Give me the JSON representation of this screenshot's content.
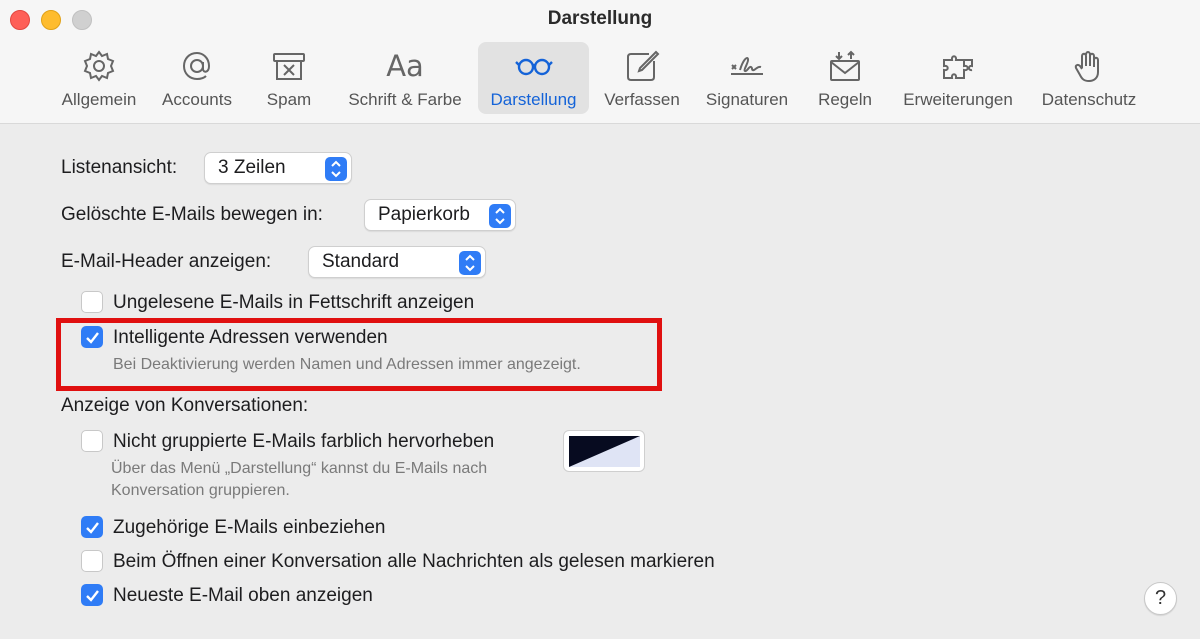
{
  "window": {
    "title": "Darstellung"
  },
  "toolbar": {
    "items": [
      {
        "label": "Allgemein",
        "icon": "gear-icon"
      },
      {
        "label": "Accounts",
        "icon": "at-sign-icon"
      },
      {
        "label": "Spam",
        "icon": "junk-tray-icon"
      },
      {
        "label": "Schrift & Farbe",
        "icon": "Aa",
        "icon_name": "font-icon"
      },
      {
        "label": "Darstellung",
        "icon": "glasses-icon",
        "selected": true
      },
      {
        "label": "Verfassen",
        "icon": "compose-icon"
      },
      {
        "label": "Signaturen",
        "icon": "signature-icon"
      },
      {
        "label": "Regeln",
        "icon": "rules-envelope-icon"
      },
      {
        "label": "Erweiterungen",
        "icon": "puzzle-icon"
      },
      {
        "label": "Datenschutz",
        "icon": "hand-icon"
      }
    ]
  },
  "settings": {
    "list_view": {
      "label": "Listenansicht:",
      "value": "3 Zeilen"
    },
    "deleted_move": {
      "label": "Gelöschte E-Mails bewegen in:",
      "value": "Papierkorb"
    },
    "header_show": {
      "label": "E-Mail-Header anzeigen:",
      "value": "Standard"
    },
    "unread_bold": {
      "label": "Ungelesene E-Mails in Fettschrift anzeigen",
      "checked": false
    },
    "smart_addresses": {
      "label": "Intelligente Adressen verwenden",
      "hint": "Bei Deaktivierung werden Namen und Adressen immer angezeigt.",
      "checked": true
    },
    "conversations_heading": "Anzeige von Konversationen:",
    "highlight_ungrouped": {
      "label": "Nicht gruppierte E-Mails farblich hervorheben",
      "hint_line1": "Über das Menü „Darstellung“ kannst du E-Mails nach",
      "hint_line2": "Konversation gruppieren.",
      "checked": false
    },
    "include_related": {
      "label": "Zugehörige E-Mails einbeziehen",
      "checked": true
    },
    "mark_all_read": {
      "label": "Beim Öffnen einer Konversation alle Nachrichten als gelesen markieren",
      "checked": false
    },
    "newest_on_top": {
      "label": "Neueste E-Mail oben anzeigen",
      "checked": true
    }
  },
  "help": {
    "label": "?"
  },
  "colors": {
    "accent": "#2f7cf6",
    "highlight_box": "#e01010",
    "selected_tab_text": "#1463d8"
  }
}
